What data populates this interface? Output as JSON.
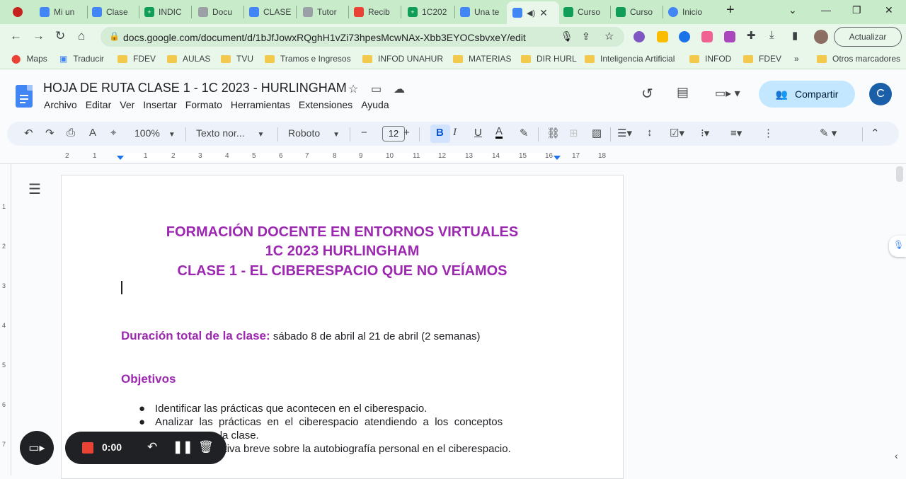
{
  "browser": {
    "tabs": [
      {
        "label": "Mi un",
        "color": "#4285f4"
      },
      {
        "label": "Clase",
        "color": "#4285f4"
      },
      {
        "label": "INDIC",
        "color": "#0f9d58"
      },
      {
        "label": "Docu",
        "color": "#9aa0a6"
      },
      {
        "label": "CLASE",
        "color": "#4285f4"
      },
      {
        "label": "Tutor",
        "color": "#9aa0a6"
      },
      {
        "label": "Recib",
        "color": "#ea4335"
      },
      {
        "label": "1C202",
        "color": "#0f9d58"
      },
      {
        "label": "Una te",
        "color": "#4285f4"
      },
      {
        "label": "",
        "color": "#4285f4"
      },
      {
        "label": "Curso",
        "color": "#0f9d58"
      },
      {
        "label": "Curso",
        "color": "#0f9d58"
      },
      {
        "label": "Inicio",
        "color": "#4285f4"
      }
    ],
    "url": "docs.google.com/document/d/1bJfJowxRQghH1vZi73hpesMcwNAx-Xbb3EYOCsbvxeY/edit",
    "update_label": "Actualizar",
    "bookmarks": [
      "Maps",
      "Traducir",
      "FDEV",
      "AULAS",
      "TVU",
      "Tramos e Ingresos",
      "INFOD UNAHUR",
      "MATERIAS",
      "DIR HURL",
      "Inteligencia Artificial",
      "INFOD",
      "FDEV"
    ],
    "bookmarks_more": "»",
    "other_bookmarks": "Otros marcadores"
  },
  "docs": {
    "title": "HOJA DE RUTA CLASE  1 - 1C 2023 - HURLINGHAM",
    "menu": [
      "Archivo",
      "Editar",
      "Ver",
      "Insertar",
      "Formato",
      "Herramientas",
      "Extensiones",
      "Ayuda"
    ],
    "share_label": "Compartir",
    "avatar_letter": "C",
    "toolbar": {
      "zoom": "100%",
      "style": "Texto nor...",
      "font": "Roboto",
      "font_size": "12"
    },
    "ruler_numbers": [
      "2",
      "1",
      "1",
      "2",
      "3",
      "4",
      "5",
      "6",
      "7",
      "8",
      "9",
      "10",
      "11",
      "12",
      "13",
      "14",
      "15",
      "16",
      "17",
      "18"
    ],
    "vruler_numbers": [
      "1",
      "2",
      "3",
      "4",
      "5",
      "6",
      "7"
    ]
  },
  "document": {
    "heading_lines": [
      "FORMACIÓN DOCENTE EN ENTORNOS VIRTUALES",
      "1C 2023 HURLINGHAM",
      "CLASE 1  - EL CIBERESPACIO QUE NO VEÍAMOS"
    ],
    "duration_label": "Duración total de la clase:",
    "duration_value": " sábado 8 de abril al 21 de abril  (2 semanas)",
    "objectives_heading": "Objetivos",
    "bullets": [
      "Identificar las prácticas que acontecen en el ciberespacio.",
      "Analizar  las  prácticas  en  el  ciberespacio  atendiendo  a  los  conceptos",
      "                 en la clase.",
      "                 arrativa breve sobre la autobiografía personal en el ciberespacio."
    ]
  },
  "recorder": {
    "time": "0:00"
  },
  "colors": {
    "accent_purple": "#9c27b0",
    "share_bg": "#c2e7ff",
    "tabstrip_bg": "#c8ebc9"
  }
}
